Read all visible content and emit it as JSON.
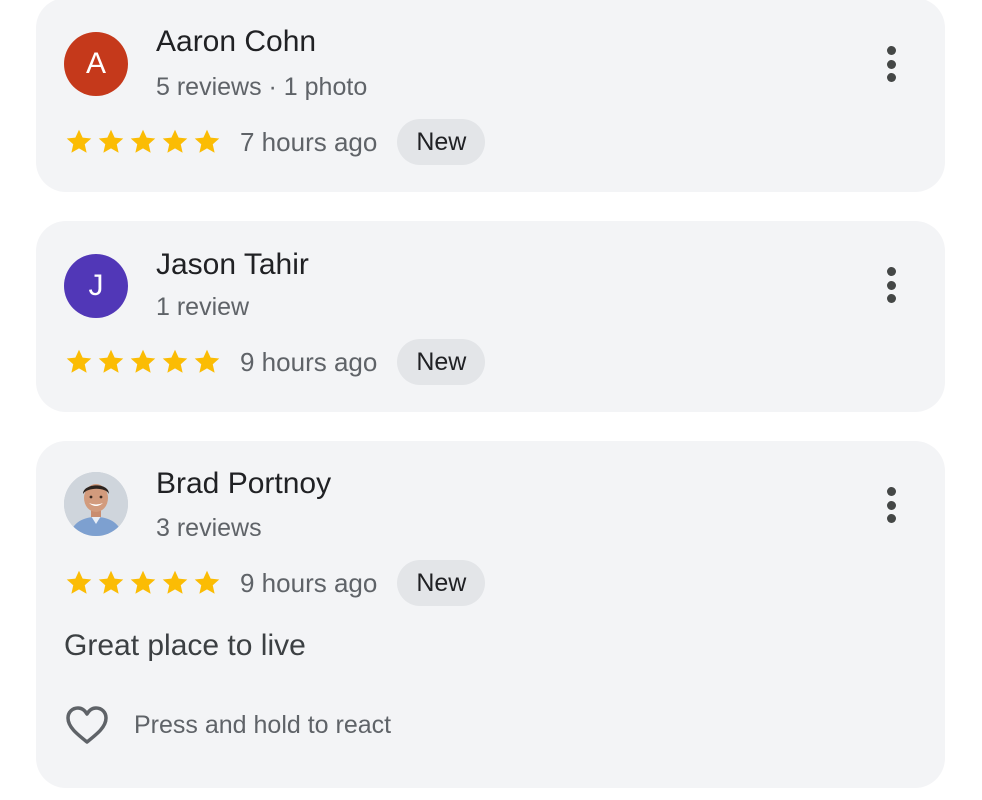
{
  "colors": {
    "card_background": "#f3f4f6",
    "badge_background": "#e3e5e8",
    "star": "#fbbc04",
    "avatar_a": "#c5391b",
    "avatar_j": "#5137b7",
    "more_icon": "#444746"
  },
  "reviews": [
    {
      "avatar_letter": "A",
      "avatar_color": "#c5391b",
      "name": "Aaron Cohn",
      "meta": "5 reviews · 1 photo",
      "rating": 5,
      "time": "7 hours ago",
      "badge": "New",
      "more_icon": "more-vert-icon"
    },
    {
      "avatar_letter": "J",
      "avatar_color": "#5137b7",
      "name": "Jason Tahir",
      "meta": "1 review",
      "rating": 5,
      "time": "9 hours ago",
      "badge": "New",
      "more_icon": "more-vert-icon"
    },
    {
      "avatar_letter": "",
      "avatar_type": "profile-photo",
      "name": "Brad Portnoy",
      "meta": "3 reviews",
      "rating": 5,
      "time": "9 hours ago",
      "badge": "New",
      "text": "Great place to live",
      "react_label": "Press and hold to react",
      "react_icon": "heart-outline-icon",
      "more_icon": "more-vert-icon"
    }
  ]
}
